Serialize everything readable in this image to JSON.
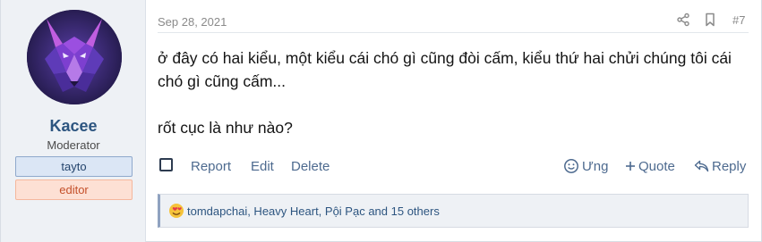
{
  "user": {
    "name": "Kacee",
    "title": "Moderator",
    "banners": [
      "tayto",
      "editor"
    ],
    "avatar_icon": "wolf-avatar"
  },
  "post": {
    "date": "Sep 28, 2021",
    "number": "#7",
    "share_icon": "share-icon",
    "bookmark_icon": "bookmark-icon",
    "message": {
      "line1": "ở đây có hai kiểu, một kiểu cái chó gì cũng đòi cấm, kiểu thứ hai chửi chúng tôi cái chó gì cũng cấm...",
      "line2": "rốt cục là như nào?"
    }
  },
  "actions": {
    "report": "Report",
    "edit": "Edit",
    "delete": "Delete",
    "like": "Ưng",
    "quote": "Quote",
    "reply": "Reply"
  },
  "reactions": {
    "text": "tomdapchai, Heavy Heart, Pội Pạc and 15 others",
    "icon": "love-reaction-icon"
  },
  "colors": {
    "link": "#4d6a8f",
    "username": "#2d5580",
    "sidebar_bg": "#eef1f5"
  }
}
